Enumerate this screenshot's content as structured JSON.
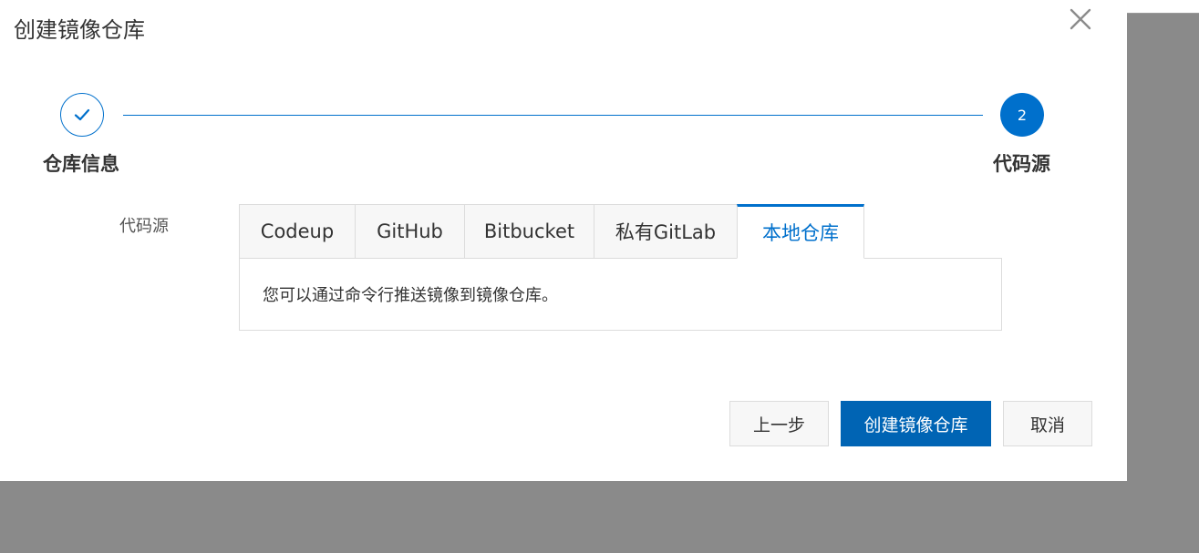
{
  "dialog": {
    "title": "创建镜像仓库"
  },
  "steps": [
    {
      "label": "仓库信息",
      "status": "completed"
    },
    {
      "label": "代码源",
      "number": "2",
      "status": "current"
    }
  ],
  "form": {
    "source_label": "代码源"
  },
  "tabs": [
    {
      "label": "Codeup",
      "active": false
    },
    {
      "label": "GitHub",
      "active": false
    },
    {
      "label": "Bitbucket",
      "active": false
    },
    {
      "label": "私有GitLab",
      "active": false
    },
    {
      "label": "本地仓库",
      "active": true
    }
  ],
  "tab_panel": {
    "text": "您可以通过命令行推送镜像到镜像仓库。"
  },
  "footer": {
    "prev_label": "上一步",
    "create_label": "创建镜像仓库",
    "cancel_label": "取消"
  },
  "colors": {
    "primary": "#0070cc",
    "primary_button": "#0064b4",
    "backdrop": "#8a8a8a"
  },
  "icons": {
    "close": "close-icon",
    "step_done": "check-icon"
  }
}
